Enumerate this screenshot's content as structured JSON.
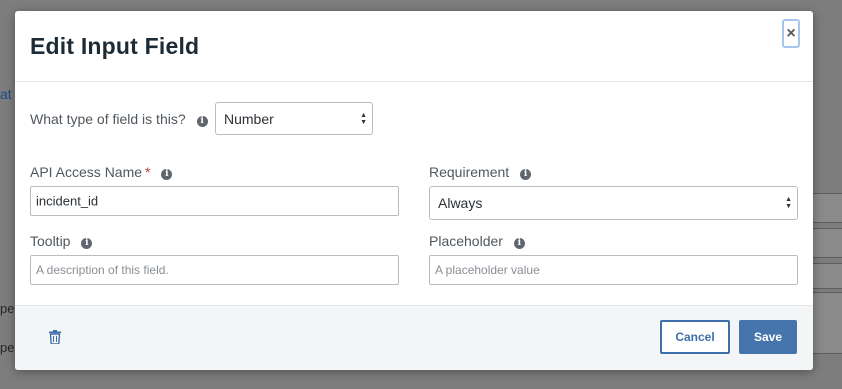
{
  "background": {
    "link_fragment": "at T",
    "text_fragment_a": "pe",
    "text_fragment_b": "pe"
  },
  "modal": {
    "title": "Edit Input Field",
    "close_label": "×"
  },
  "form": {
    "field_type": {
      "label": "What type of field is this?",
      "value": "Number"
    },
    "api_name": {
      "label": "API Access Name",
      "required_marker": "*",
      "value": "incident_id"
    },
    "requirement": {
      "label": "Requirement",
      "value": "Always"
    },
    "tooltip": {
      "label": "Tooltip",
      "placeholder": "A description of this field.",
      "value": ""
    },
    "placeholder": {
      "label": "Placeholder",
      "placeholder": "A placeholder value",
      "value": ""
    },
    "info_glyph": "i"
  },
  "footer": {
    "cancel_label": "Cancel",
    "save_label": "Save"
  },
  "colors": {
    "primary": "#4675ad",
    "required": "#c0392b",
    "overlay": "#7d7d7d"
  },
  "icons": [
    "info-icon",
    "close-icon",
    "trash-icon",
    "select-arrows-icon"
  ]
}
